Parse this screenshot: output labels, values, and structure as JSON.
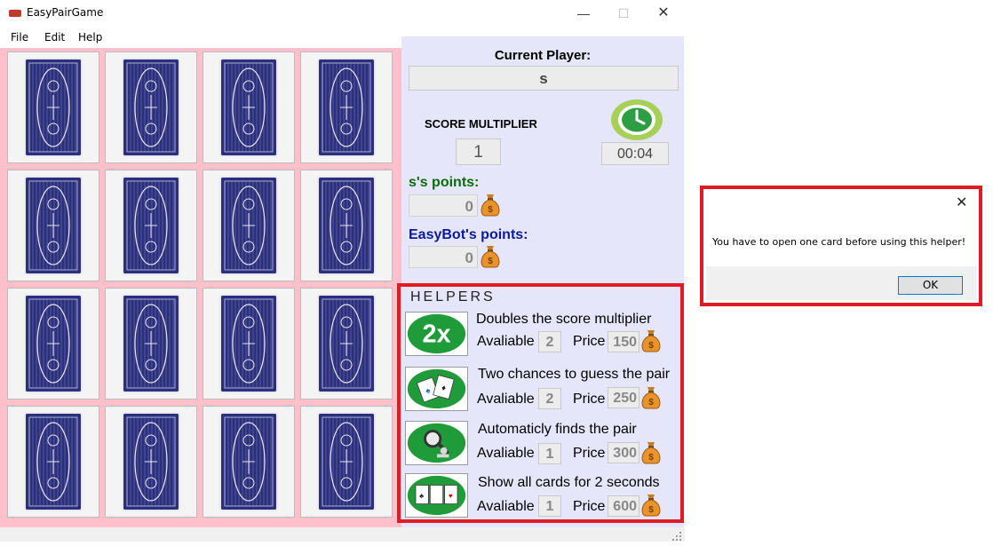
{
  "window": {
    "title": "EasyPairGame",
    "minimize": "—",
    "maximize": "☐",
    "close": "✕"
  },
  "menu": {
    "file": "File",
    "edit": "Edit",
    "help": "Help"
  },
  "board": {
    "rows": 4,
    "cols": 4,
    "card_state": "face-down"
  },
  "player": {
    "label": "Current Player:",
    "name": "s"
  },
  "multiplier": {
    "label": "SCORE MULTIPLIER",
    "value": "1"
  },
  "timer": {
    "value": "00:04"
  },
  "scores": {
    "p1_label": "s's points:",
    "p1_value": "0",
    "p1_color": "#0b6b0b",
    "p2_label": "EasyBot's points:",
    "p2_value": "0",
    "p2_color": "#0a1a9a"
  },
  "helpers": {
    "title": "HELPERS",
    "avail_label": "Avaliable",
    "price_label": "Price",
    "items": [
      {
        "desc": "Doubles the score multiplier",
        "available": "2",
        "price": "150",
        "icon": "2x-icon"
      },
      {
        "desc": "Two chances to guess the pair",
        "available": "2",
        "price": "250",
        "icon": "cards-icon"
      },
      {
        "desc": "Automaticly finds the pair",
        "available": "1",
        "price": "300",
        "icon": "magnifier-icon"
      },
      {
        "desc": "Show all cards for 2 seconds",
        "available": "1",
        "price": "600",
        "icon": "show-cards-icon"
      }
    ]
  },
  "dialog": {
    "message": "You have to open one card before using this helper!",
    "ok": "OK",
    "close": "✕"
  },
  "colors": {
    "board_bg": "#ffc0cb",
    "panel_bg": "#e6e6fa",
    "highlight": "#e01b24",
    "helper_green": "#1f9b3a"
  }
}
